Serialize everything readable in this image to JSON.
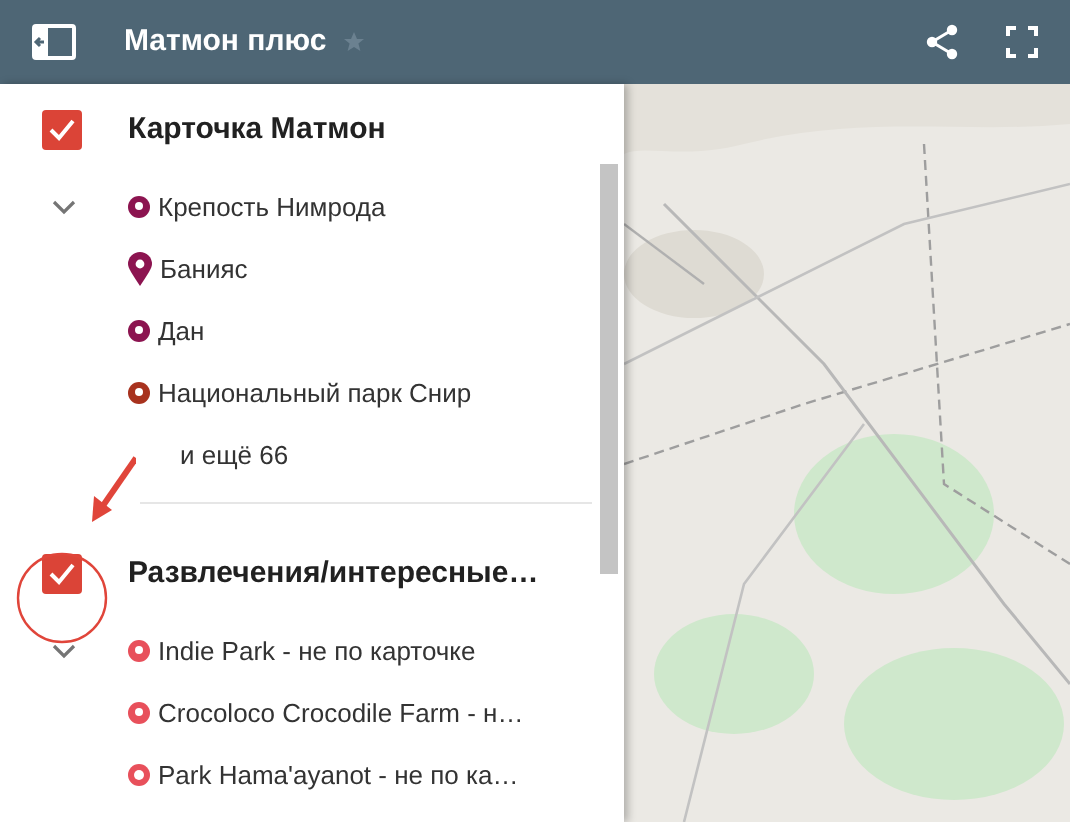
{
  "header": {
    "title": "Матмон плюс",
    "starred": false
  },
  "layers": [
    {
      "title": "Карточка Матмон",
      "checked": true,
      "expanded": true,
      "items": [
        {
          "name": "Крепость Нимрода",
          "color": "#8c1450",
          "kind": "circle"
        },
        {
          "name": "Банияс",
          "color": "#8c1450",
          "kind": "pin"
        },
        {
          "name": "Дан",
          "color": "#8c1450",
          "kind": "circle"
        },
        {
          "name": "Национальный парк Снир",
          "color": "#a8321e",
          "kind": "circle"
        }
      ],
      "more": "и ещё 66"
    },
    {
      "title": "Развлечения/интересные…",
      "checked": true,
      "expanded": true,
      "items": [
        {
          "name": "Indie Park - не по карточке",
          "color": "#e8505b",
          "kind": "circle"
        },
        {
          "name": "Crocoloco Crocodile Farm - н…",
          "color": "#e8505b",
          "kind": "circle"
        },
        {
          "name": "Park Hama'ayanot - не по ка…",
          "color": "#e8505b",
          "kind": "ring"
        }
      ]
    }
  ]
}
